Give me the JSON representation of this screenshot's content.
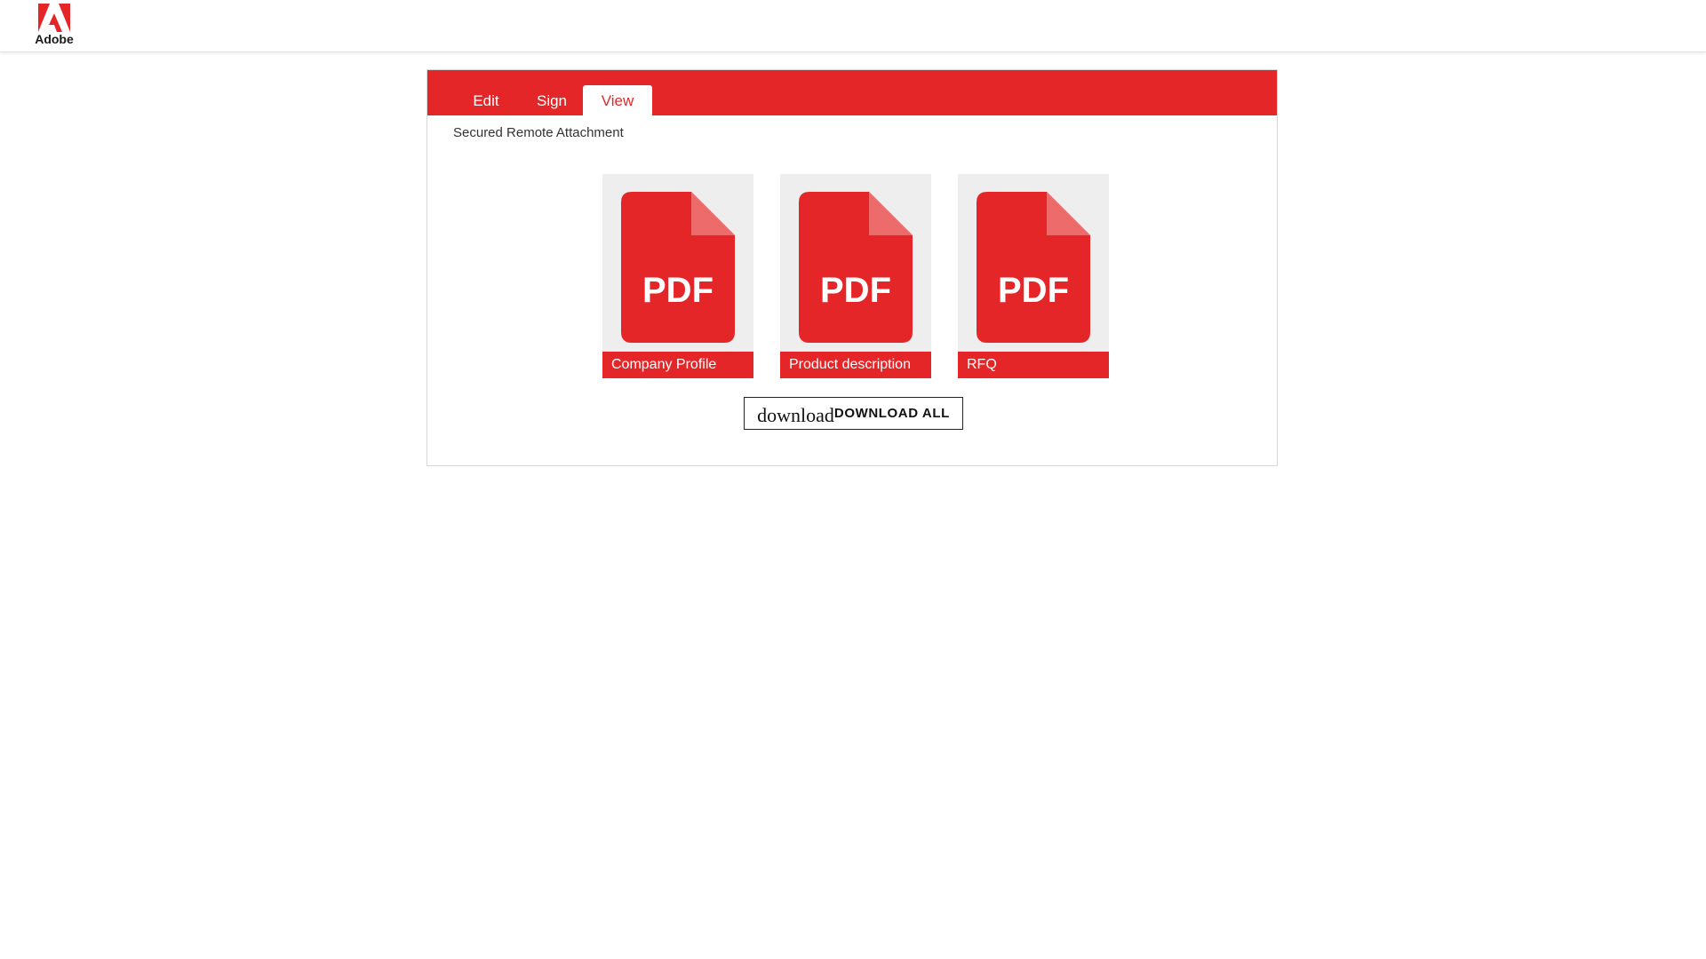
{
  "header": {
    "logo_text": "Adobe",
    "logo_icon": "adobe-logo-icon",
    "brand_color": "#e52628"
  },
  "tabs": [
    {
      "label": "Edit",
      "active": false
    },
    {
      "label": "Sign",
      "active": false
    },
    {
      "label": "View",
      "active": true
    }
  ],
  "subtitle": "Secured Remote Attachment",
  "files": [
    {
      "icon_text": "PDF",
      "name": "Company Profile"
    },
    {
      "icon_text": "PDF",
      "name": "Product description"
    },
    {
      "icon_text": "PDF",
      "name": "RFQ"
    }
  ],
  "download": {
    "icon_text": "download",
    "label": "DOWNLOAD ALL"
  }
}
